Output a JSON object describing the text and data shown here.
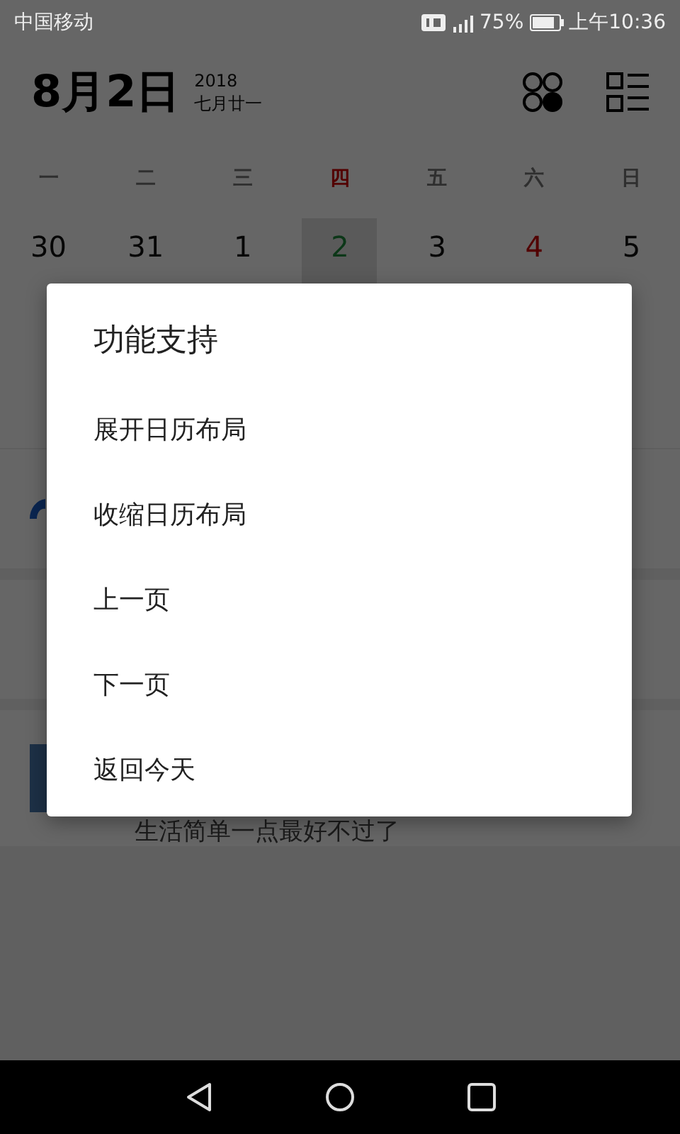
{
  "status_bar": {
    "carrier": "中国移动",
    "battery": "75%",
    "time": "上午10:36"
  },
  "header": {
    "date": "8月2日",
    "year": "2018",
    "lunar": "七月廿一"
  },
  "weekdays": [
    {
      "label": "一",
      "highlight": false
    },
    {
      "label": "二",
      "highlight": false
    },
    {
      "label": "三",
      "highlight": false
    },
    {
      "label": "四",
      "highlight": true
    },
    {
      "label": "五",
      "highlight": false
    },
    {
      "label": "六",
      "highlight": false
    },
    {
      "label": "日",
      "highlight": false
    }
  ],
  "days": [
    {
      "day": "30",
      "kind": "normal",
      "selected": false
    },
    {
      "day": "31",
      "kind": "normal",
      "selected": false
    },
    {
      "day": "1",
      "kind": "normal",
      "selected": false
    },
    {
      "day": "2",
      "kind": "today",
      "selected": true
    },
    {
      "day": "3",
      "kind": "normal",
      "selected": false
    },
    {
      "day": "4",
      "kind": "holiday",
      "selected": false
    },
    {
      "day": "5",
      "kind": "normal",
      "selected": false
    }
  ],
  "feed": [
    {
      "kind": "logo"
    },
    {
      "kind": "blank"
    },
    {
      "kind": "article",
      "text": "生活简单一点最好不过了"
    }
  ],
  "dialog": {
    "title": "功能支持",
    "items": [
      "展开日历布局",
      "收缩日历布局",
      "上一页",
      "下一页",
      "返回今天"
    ]
  }
}
